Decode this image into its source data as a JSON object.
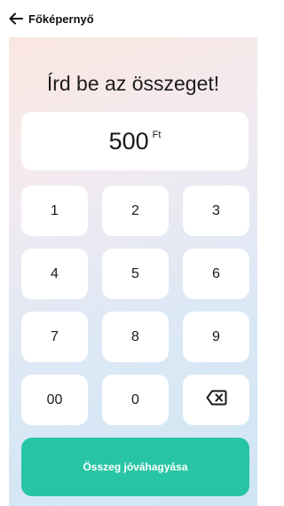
{
  "header": {
    "back_label": "Főképernyő"
  },
  "main": {
    "prompt": "Írd be az összeget!",
    "amount": "500",
    "currency": "Ft"
  },
  "keypad": {
    "keys": [
      "1",
      "2",
      "3",
      "4",
      "5",
      "6",
      "7",
      "8",
      "9",
      "00",
      "0"
    ],
    "backspace_icon": "backspace-icon"
  },
  "confirm_label": "Összeg jóváhagyása",
  "colors": {
    "accent": "#28c5a5"
  }
}
